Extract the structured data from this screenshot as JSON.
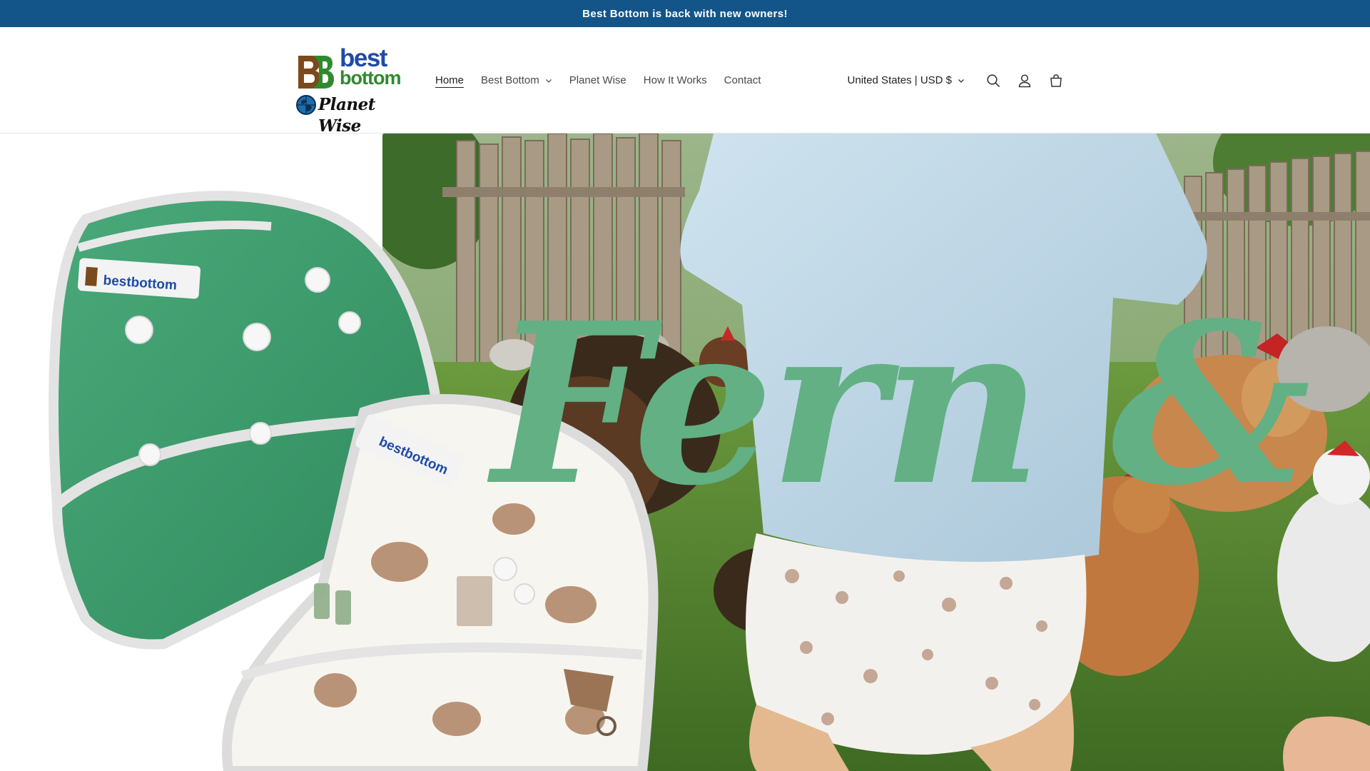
{
  "announcement": {
    "text": "Best Bottom is back with new owners!"
  },
  "logo": {
    "word_best": "best",
    "word_bottom": "bottom",
    "word_planet_wise": "Planet Wise"
  },
  "nav": {
    "items": [
      {
        "label": "Home",
        "active": true
      },
      {
        "label": "Best Bottom",
        "has_dropdown": true
      },
      {
        "label": "Planet Wise"
      },
      {
        "label": "How It Works"
      },
      {
        "label": "Contact"
      }
    ]
  },
  "header_utils": {
    "country_selector": "United States | USD $",
    "icons": [
      "search-icon",
      "account-icon",
      "cart-icon"
    ]
  },
  "hero": {
    "title": "Fern &",
    "title_color": "#62b084",
    "diaper_tag_text": "bestbottom"
  },
  "colors": {
    "announcement_bg": "#135589",
    "brand_blue": "#1f4aa6",
    "brand_green": "#2f8a2f",
    "brand_brown": "#7a4a1c"
  }
}
